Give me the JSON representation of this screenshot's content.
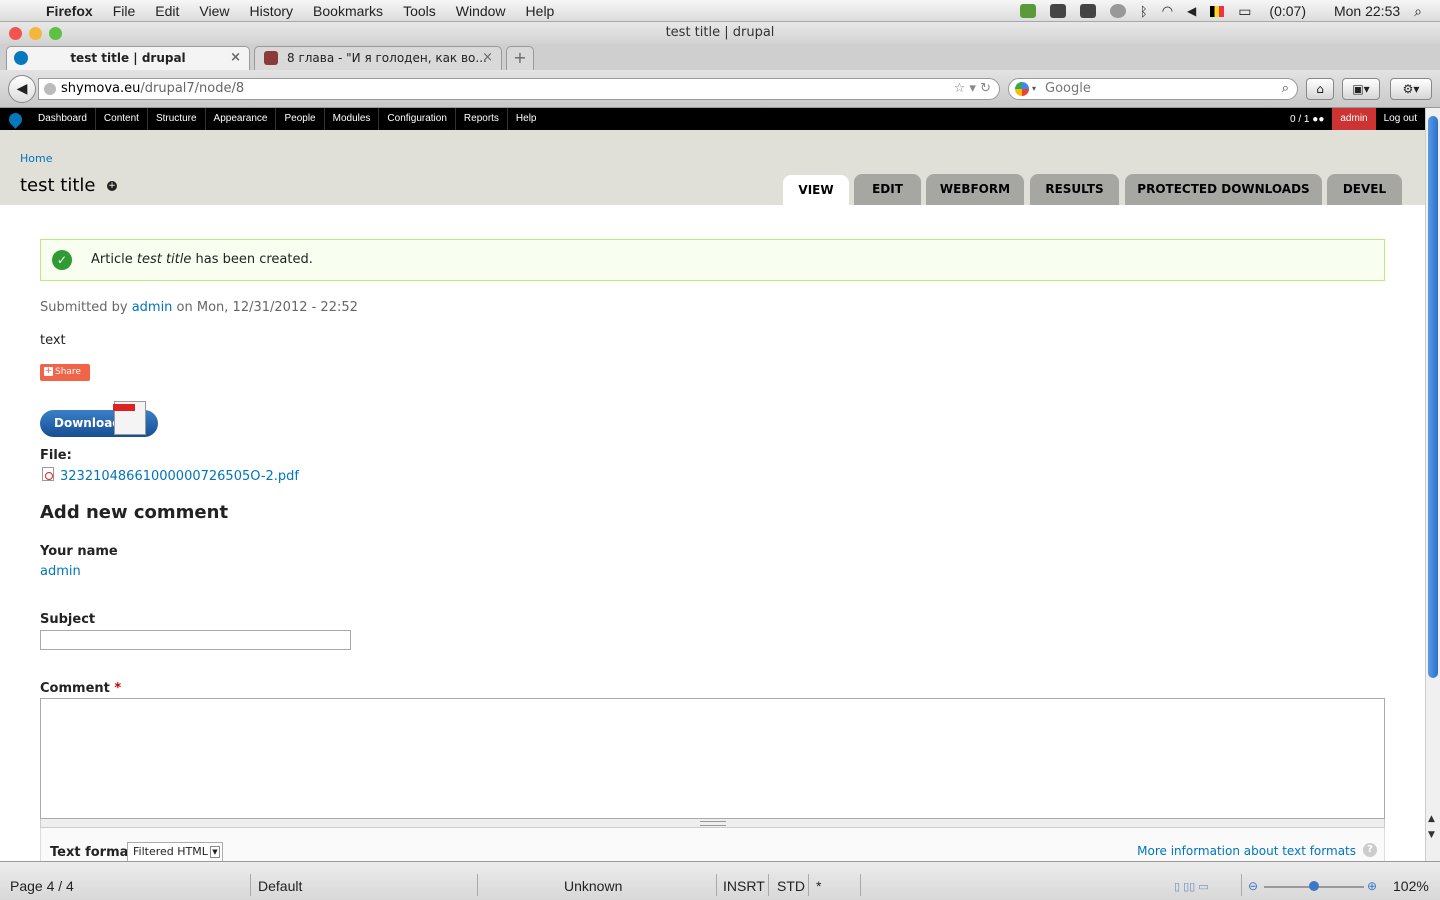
{
  "menubar": {
    "app_name": "Firefox",
    "items": [
      "File",
      "Edit",
      "View",
      "History",
      "Bookmarks",
      "Tools",
      "Window",
      "Help"
    ],
    "battery": "(0:07)",
    "clock": "Mon 22:53"
  },
  "window": {
    "title": "test title | drupal"
  },
  "tabs": [
    {
      "label": "test title | drupal",
      "active": true
    },
    {
      "label": "8 глава - \"И я голоден, как во...",
      "active": false
    }
  ],
  "navbar": {
    "url_host": "shymova.eu",
    "url_path": "/drupal7/node/8",
    "search_placeholder": "Google"
  },
  "admin_toolbar": {
    "items": [
      "Dashboard",
      "Content",
      "Structure",
      "Appearance",
      "People",
      "Modules",
      "Configuration",
      "Reports",
      "Help"
    ],
    "user_count": "0 / 1",
    "user": "admin",
    "logout": "Log out"
  },
  "page": {
    "breadcrumb": "Home",
    "title": "test title",
    "tabs": [
      "VIEW",
      "EDIT",
      "WEBFORM",
      "RESULTS",
      "PROTECTED DOWNLOADS",
      "DEVEL"
    ]
  },
  "message": {
    "prefix": "Article ",
    "emph": "test title",
    "suffix": " has been created."
  },
  "node": {
    "submitted_prefix": "Submitted by ",
    "author": "admin",
    "submitted_suffix": " on Mon, 12/31/2012 - 22:52",
    "body": "text",
    "share_label": "Share",
    "download_label": "Download",
    "file_label": "File:",
    "file_name": "32321048661000000726505O-2.pdf"
  },
  "comment_form": {
    "heading": "Add new comment",
    "name_label": "Your name",
    "name_value": "admin",
    "subject_label": "Subject",
    "comment_label": "Comment",
    "required_marker": "*",
    "text_format_label": "Text format",
    "text_format_value": "Filtered HTML",
    "more_info": "More information about text formats"
  },
  "statusbar": {
    "page": "Page 4 / 4",
    "style": "Default",
    "language": "Unknown",
    "insert_mode": "INSRT",
    "selection_mode": "STD",
    "modified": "*",
    "zoom": "102%"
  }
}
